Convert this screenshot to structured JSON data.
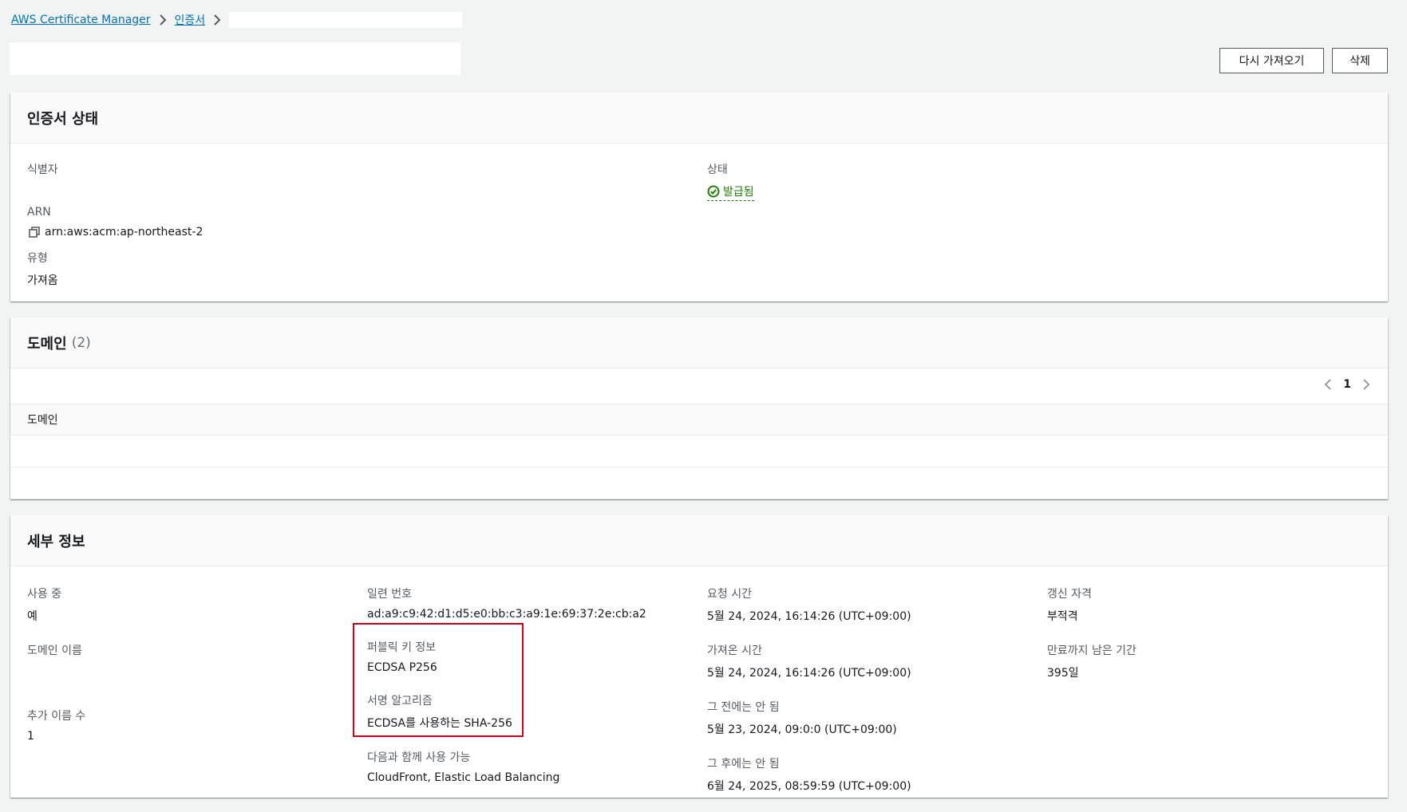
{
  "breadcrumb": {
    "service": "AWS Certificate Manager",
    "certificates": "인증서"
  },
  "actions": {
    "reimport": "다시 가져오기",
    "delete": "삭제"
  },
  "status_panel": {
    "title": "인증서 상태",
    "identifier_label": "식별자",
    "status_label": "상태",
    "status_value": "발급됨",
    "arn_label": "ARN",
    "arn_value": "arn:aws:acm:ap-northeast-2",
    "type_label": "유형",
    "type_value": "가져옴"
  },
  "domain_panel": {
    "title": "도메인",
    "count": "(2)",
    "page": "1",
    "column_header": "도메인"
  },
  "details_panel": {
    "title": "세부 정보",
    "in_use_label": "사용 중",
    "in_use_value": "예",
    "domain_name_label": "도메인 이름",
    "additional_names_label": "추가 이름 수",
    "additional_names_value": "1",
    "serial_label": "일련 번호",
    "serial_value": "ad:a9:c9:42:d1:d5:e0:bb:c3:a9:1e:69:37:2e:cb:a2",
    "public_key_label": "퍼블릭 키 정보",
    "public_key_value": "ECDSA P256",
    "signature_label": "서명 알고리즘",
    "signature_value": "ECDSA를 사용하는 SHA-256",
    "eligible_label": "다음과 함께 사용 가능",
    "eligible_value": "CloudFront, Elastic Load Balancing",
    "requested_label": "요청 시간",
    "requested_value": "5월 24, 2024, 16:14:26 (UTC+09:00)",
    "imported_label": "가져온 시간",
    "imported_value": "5월 24, 2024, 16:14:26 (UTC+09:00)",
    "not_before_label": "그 전에는 안 됨",
    "not_before_value": "5월 23, 2024, 09:0:0 (UTC+09:00)",
    "not_after_label": "그 후에는 안 됨",
    "not_after_value": "6월 24, 2025, 08:59:59 (UTC+09:00)",
    "renewal_label": "갱신 자격",
    "renewal_value": "부적격",
    "days_left_label": "만료까지 남은 기간",
    "days_left_value": "395일"
  },
  "colors": {
    "link": "#0073bb",
    "success": "#1d8102",
    "highlight": "#d0021b"
  }
}
